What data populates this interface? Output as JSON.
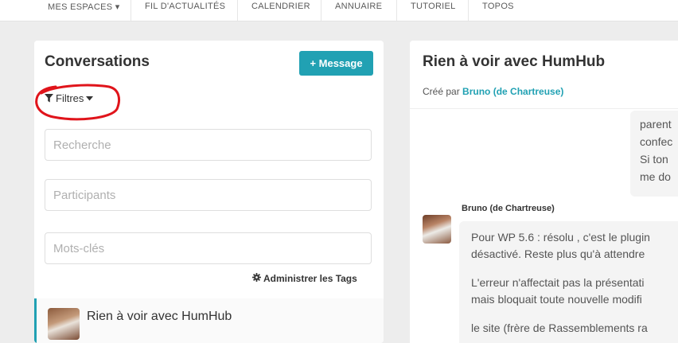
{
  "topnav": {
    "items": [
      "MES ESPACES ▾",
      "FIL D'ACTUALITÉS",
      "CALENDRIER",
      "ANNUAIRE",
      "TUTORIEL",
      "TOPOS"
    ]
  },
  "left": {
    "title": "Conversations",
    "new_message_label": "+ Message",
    "filters_label": "Filtres",
    "search_placeholder": "Recherche",
    "participants_placeholder": "Participants",
    "keywords_placeholder": "Mots-clés",
    "admin_tags_label": "Administrer les Tags",
    "conversation": {
      "title": "Rien à voir avec HumHub"
    }
  },
  "right": {
    "title": "Rien à voir avec HumHub",
    "created_by_prefix": "Créé par",
    "created_by_author": "Bruno (de Chartreuse)",
    "top_message_lines": [
      "parent",
      "confec",
      "Si ton",
      "me do"
    ],
    "sender_name": "Bruno (de Chartreuse)",
    "message_lines": [
      "Pour WP 5.6 : résolu , c'est le plugin",
      "désactivé. Reste plus qu'à attendre",
      "L'erreur n'affectait pas la présentati",
      "mais bloquait toute nouvelle modifi",
      "le site (frère de Rassemblements ra"
    ]
  },
  "colors": {
    "accent": "#21a1b3",
    "annotation": "#e0141b"
  },
  "icons": {
    "filter": "filter-icon",
    "caret": "caret-down-icon",
    "gear": "gear-icon"
  }
}
